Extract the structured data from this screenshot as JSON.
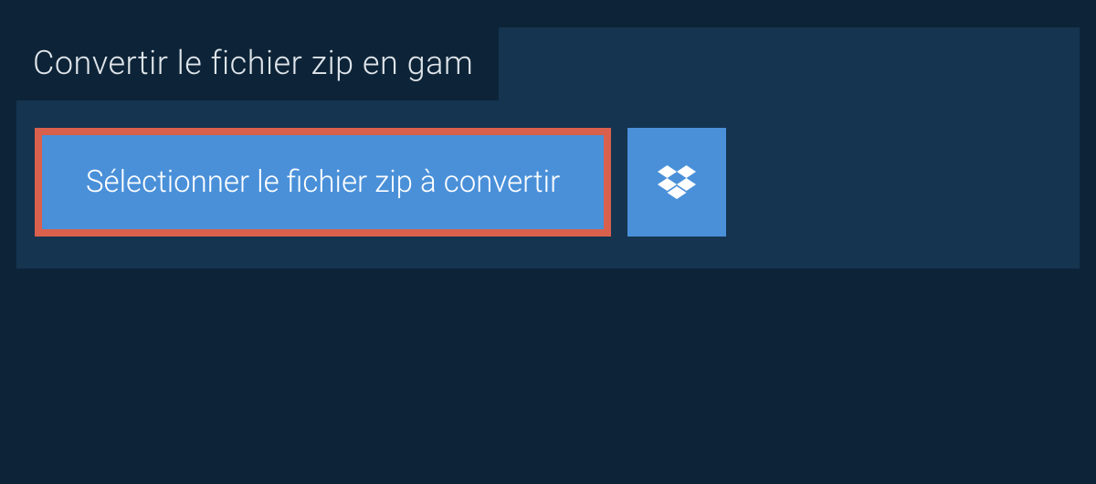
{
  "header": {
    "title": "Convertir le fichier zip en gam"
  },
  "buttons": {
    "select_file_label": "Sélectionner le fichier zip à convertir"
  }
}
